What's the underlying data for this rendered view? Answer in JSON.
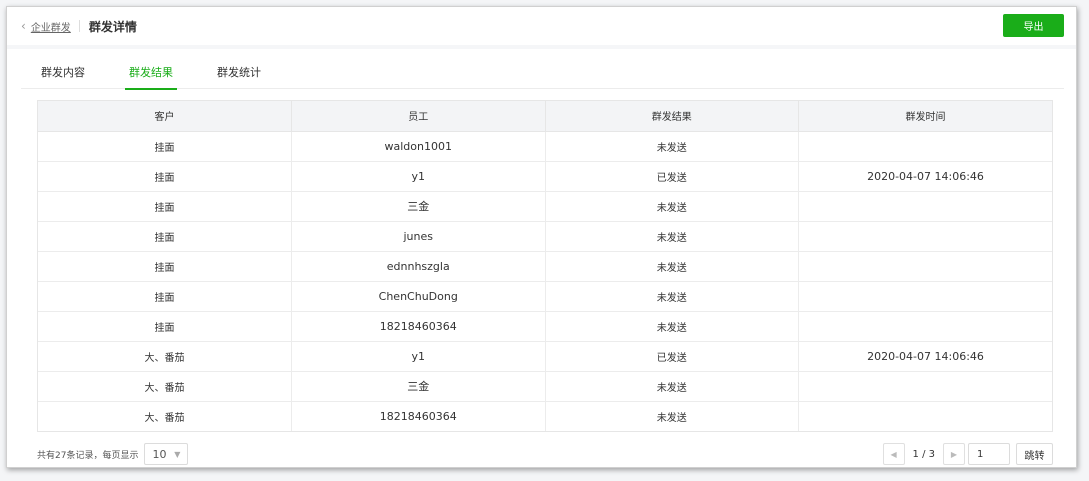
{
  "header": {
    "back_icon": "chevron-left-icon",
    "breadcrumb_parent": "企业群发",
    "title": "群发详情",
    "export_label": "导出"
  },
  "tabs": [
    {
      "label": "群发内容",
      "active": false
    },
    {
      "label": "群发结果",
      "active": true
    },
    {
      "label": "群发统计",
      "active": false
    }
  ],
  "table": {
    "columns": [
      "客户",
      "员工",
      "群发结果",
      "群发时间"
    ],
    "rows": [
      {
        "customer": "挂面",
        "employee": "waldon1001",
        "result": "未发送",
        "time": ""
      },
      {
        "customer": "挂面",
        "employee": "y1",
        "result": "已发送",
        "time": "2020-04-07 14:06:46"
      },
      {
        "customer": "挂面",
        "employee": "三金",
        "result": "未发送",
        "time": ""
      },
      {
        "customer": "挂面",
        "employee": "junes",
        "result": "未发送",
        "time": ""
      },
      {
        "customer": "挂面",
        "employee": "ednnhszgla",
        "result": "未发送",
        "time": ""
      },
      {
        "customer": "挂面",
        "employee": "ChenChuDong",
        "result": "未发送",
        "time": ""
      },
      {
        "customer": "挂面",
        "employee": "18218460364",
        "result": "未发送",
        "time": ""
      },
      {
        "customer": "大、番茄",
        "employee": "y1",
        "result": "已发送",
        "time": "2020-04-07 14:06:46"
      },
      {
        "customer": "大、番茄",
        "employee": "三金",
        "result": "未发送",
        "time": ""
      },
      {
        "customer": "大、番茄",
        "employee": "18218460364",
        "result": "未发送",
        "time": ""
      }
    ]
  },
  "footer": {
    "summary": "共有27条记录，每页显示",
    "page_size": "10",
    "page_info": "1 / 3",
    "page_input": "1",
    "jump_label": "跳转"
  },
  "colors": {
    "accent": "#1aad19",
    "header_bg": "#f3f4f6"
  }
}
